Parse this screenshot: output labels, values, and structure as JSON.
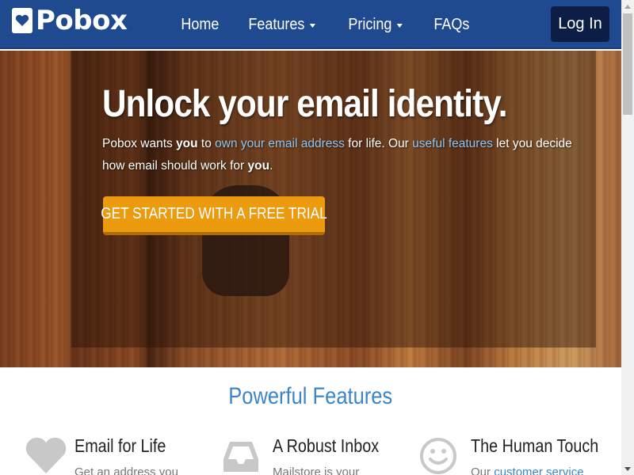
{
  "nav": {
    "brand": "Pobox",
    "links": [
      {
        "label": "Home"
      },
      {
        "label": "Features"
      },
      {
        "label": "Pricing"
      },
      {
        "label": "FAQs"
      }
    ],
    "login_label": "Log In"
  },
  "hero": {
    "title": "Unlock your email identity.",
    "text": {
      "p1": "Pobox wants ",
      "b1": "you",
      "p2": " to ",
      "link1": "own your email address",
      "p3": " for life. Our ",
      "link2": "useful features",
      "p4": " let you decide how email should work for ",
      "b2": "you",
      "p5": "."
    },
    "cta_label": "GET STARTED WITH A FREE TRIAL"
  },
  "features": {
    "title": "Powerful Features",
    "items": [
      {
        "icon": "heart-icon",
        "title": "Email for Life",
        "desc": "Get an address you",
        "link": ""
      },
      {
        "icon": "inbox-icon",
        "title": "A Robust Inbox",
        "desc": "Mailstore is your",
        "link": ""
      },
      {
        "icon": "smiley-icon",
        "title": "The Human Touch",
        "desc": "Our ",
        "link": "customer service"
      }
    ]
  },
  "colors": {
    "nav_bg": "#1f4a8f",
    "login_bg": "#0c1e45",
    "cta": "#ec9a0e",
    "accent": "#3a86c8"
  }
}
